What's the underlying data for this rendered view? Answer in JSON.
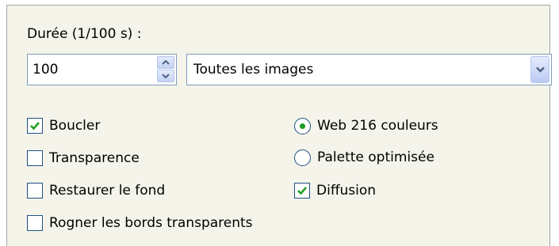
{
  "duration": {
    "label": "Durée (1/100 s) :",
    "value": "100"
  },
  "frames_select": {
    "selected": "Toutes les images"
  },
  "checkboxes": {
    "loop": {
      "label": "Boucler",
      "checked": true
    },
    "transparency": {
      "label": "Transparence",
      "checked": false
    },
    "restore_background": {
      "label": "Restaurer le fond",
      "checked": false
    },
    "crop_transparent": {
      "label": "Rogner les bords transparents",
      "checked": false
    },
    "dithering": {
      "label": "Diffusion",
      "checked": true
    }
  },
  "palette": {
    "web216": {
      "label": "Web 216 couleurs",
      "selected": true
    },
    "optimized": {
      "label": "Palette optimisée",
      "selected": false
    }
  },
  "colors": {
    "panel_bg": "#f5f4eb",
    "control_border": "#1c5180",
    "check_mark": "#21a121",
    "field_border": "#7f9db9"
  }
}
